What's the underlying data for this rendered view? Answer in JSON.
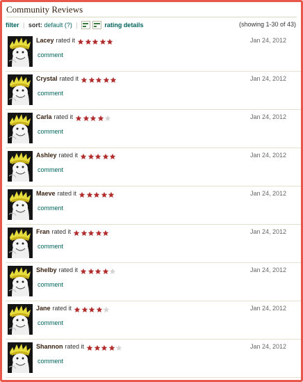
{
  "header": {
    "title": "Community Reviews"
  },
  "toolbar": {
    "filter_label": "filter",
    "sort_label": "sort:",
    "sort_value": "default (?)",
    "rating_details_label": "rating details",
    "showing_text": "(showing 1-30 of 43)"
  },
  "colors": {
    "star_filled": "#b12e2e",
    "star_empty": "#d4d4d4",
    "link": "#00635d",
    "accent_border": "#e8574a"
  },
  "reviews": [
    {
      "name": "Lacey",
      "rated_text": "rated it",
      "rating": 5,
      "date": "Jan 24, 2012",
      "comment_label": "comment"
    },
    {
      "name": "Crystal",
      "rated_text": "rated it",
      "rating": 5,
      "date": "Jan 24, 2012",
      "comment_label": "comment"
    },
    {
      "name": "Carla",
      "rated_text": "rated it",
      "rating": 4,
      "date": "Jan 24, 2012",
      "comment_label": "comment"
    },
    {
      "name": "Ashley",
      "rated_text": "rated it",
      "rating": 5,
      "date": "Jan 24, 2012",
      "comment_label": "comment"
    },
    {
      "name": "Maeve",
      "rated_text": "rated it",
      "rating": 5,
      "date": "Jan 24, 2012",
      "comment_label": "comment"
    },
    {
      "name": "Fran",
      "rated_text": "rated it",
      "rating": 5,
      "date": "Jan 24, 2012",
      "comment_label": "comment"
    },
    {
      "name": "Shelby",
      "rated_text": "rated it",
      "rating": 4,
      "date": "Jan 24, 2012",
      "comment_label": "comment"
    },
    {
      "name": "Jane",
      "rated_text": "rated it",
      "rating": 4,
      "date": "Jan 24, 2012",
      "comment_label": "comment"
    },
    {
      "name": "Shannon",
      "rated_text": "rated it",
      "rating": 4,
      "date": "Jan 24, 2012",
      "comment_label": "comment"
    }
  ]
}
